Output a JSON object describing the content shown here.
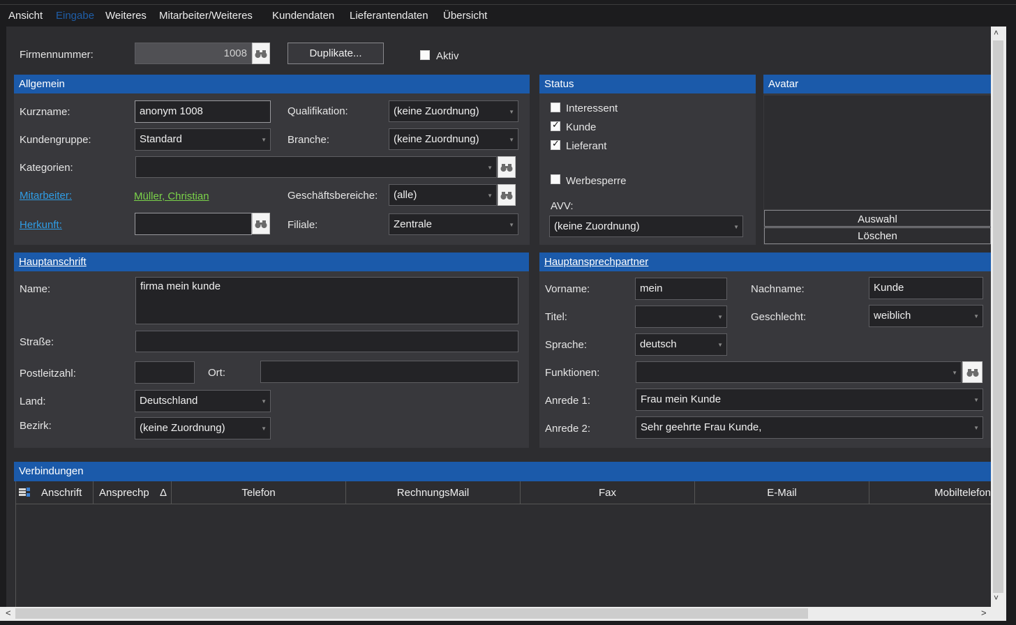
{
  "menu": {
    "items": [
      "Ansicht",
      "Eingabe",
      "Weiteres",
      "Mitarbeiter/Weiteres",
      "Kundendaten",
      "Lieferantendaten",
      "Übersicht"
    ],
    "active": "Eingabe"
  },
  "top": {
    "firmennummer_label": "Firmennummer:",
    "firmennummer_value": "1008",
    "duplikate_label": "Duplikate...",
    "aktiv_label": "Aktiv",
    "aktiv_checked": false
  },
  "allgemein": {
    "title": "Allgemein",
    "kurzname_label": "Kurzname:",
    "kurzname_value": "anonym 1008",
    "kundengruppe_label": "Kundengruppe:",
    "kundengruppe_value": "Standard",
    "kategorien_label": "Kategorien:",
    "kategorien_value": "",
    "mitarbeiter_label": "Mitarbeiter:",
    "mitarbeiter_value": "Müller, Christian",
    "herkunft_label": "Herkunft:",
    "herkunft_value": "",
    "qualifikation_label": "Qualifikation:",
    "qualifikation_value": "(keine Zuordnung)",
    "branche_label": "Branche:",
    "branche_value": "(keine Zuordnung)",
    "geschaeftsbereiche_label": "Geschäftsbereiche:",
    "geschaeftsbereiche_value": "(alle)",
    "filiale_label": "Filiale:",
    "filiale_value": "Zentrale"
  },
  "status": {
    "title": "Status",
    "interessent_label": "Interessent",
    "interessent_checked": false,
    "kunde_label": "Kunde",
    "kunde_checked": true,
    "lieferant_label": "Lieferant",
    "lieferant_checked": true,
    "werbesperre_label": "Werbesperre",
    "werbesperre_checked": false,
    "avv_label": "AVV:",
    "avv_value": "(keine Zuordnung)"
  },
  "avatar": {
    "title": "Avatar",
    "auswahl_label": "Auswahl",
    "loeschen_label": "Löschen"
  },
  "hauptanschrift": {
    "title": "Hauptanschrift",
    "name_label": "Name:",
    "name_value": "firma mein kunde",
    "strasse_label": "Straße:",
    "strasse_value": "",
    "plz_label": "Postleitzahl:",
    "plz_value": "",
    "ort_label": "Ort:",
    "ort_value": "",
    "land_label": "Land:",
    "land_value": "Deutschland",
    "bezirk_label": "Bezirk:",
    "bezirk_value": "(keine Zuordnung)"
  },
  "ansprechpartner": {
    "title": "Hauptansprechpartner",
    "vorname_label": "Vorname:",
    "vorname_value": "mein",
    "nachname_label": "Nachname:",
    "nachname_value": "Kunde",
    "titel_label": "Titel:",
    "titel_value": "",
    "geschlecht_label": "Geschlecht:",
    "geschlecht_value": "weiblich",
    "sprache_label": "Sprache:",
    "sprache_value": "deutsch",
    "funktionen_label": "Funktionen:",
    "funktionen_value": "",
    "anrede1_label": "Anrede 1:",
    "anrede1_value": "Frau mein Kunde",
    "anrede2_label": "Anrede 2:",
    "anrede2_value": "Sehr geehrte Frau Kunde,"
  },
  "verbindungen": {
    "title": "Verbindungen",
    "columns": [
      "Anschrift",
      "Ansprechp",
      "Telefon",
      "RechnungsMail",
      "Fax",
      "E-Mail",
      "Mobiltelefon"
    ],
    "sort_indicator": "Δ"
  },
  "scroll": {
    "up": "˄",
    "down": "˅",
    "left": "<",
    "right": ">"
  }
}
